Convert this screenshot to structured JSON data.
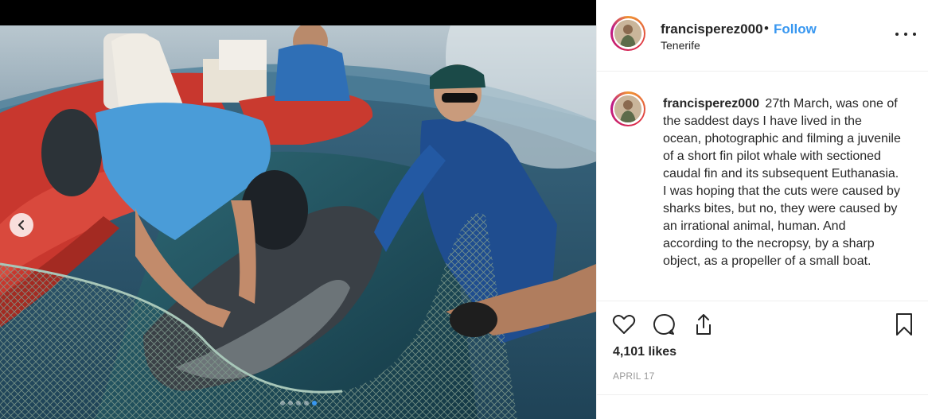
{
  "post": {
    "username": "francisperez000",
    "separator": "•",
    "follow_label": "Follow",
    "location": "Tenerife",
    "caption": "27th March, was one of the saddest days I have lived in the ocean, photographic and filming a juvenile of a short fin pilot whale with sectioned caudal fin and its subsequent Euthanasia. I was hoping that the cuts were caused by sharks bites, but no, they were caused by an irrational animal, human. And according to the necropsy, by a sharp object, as a propeller of a small boat.",
    "likes": "4,101 likes",
    "date": "APRIL 17"
  },
  "carousel": {
    "slide_count": 5,
    "active_slide": 5
  },
  "icons": {
    "prev": "chevron-left-icon",
    "more": "more-options-icon",
    "like": "heart-icon",
    "comment": "comment-icon",
    "share": "share-icon",
    "save": "bookmark-icon"
  },
  "colors": {
    "accent": "#3897f0",
    "text": "#262626",
    "muted": "#999999",
    "border": "#efefef"
  }
}
